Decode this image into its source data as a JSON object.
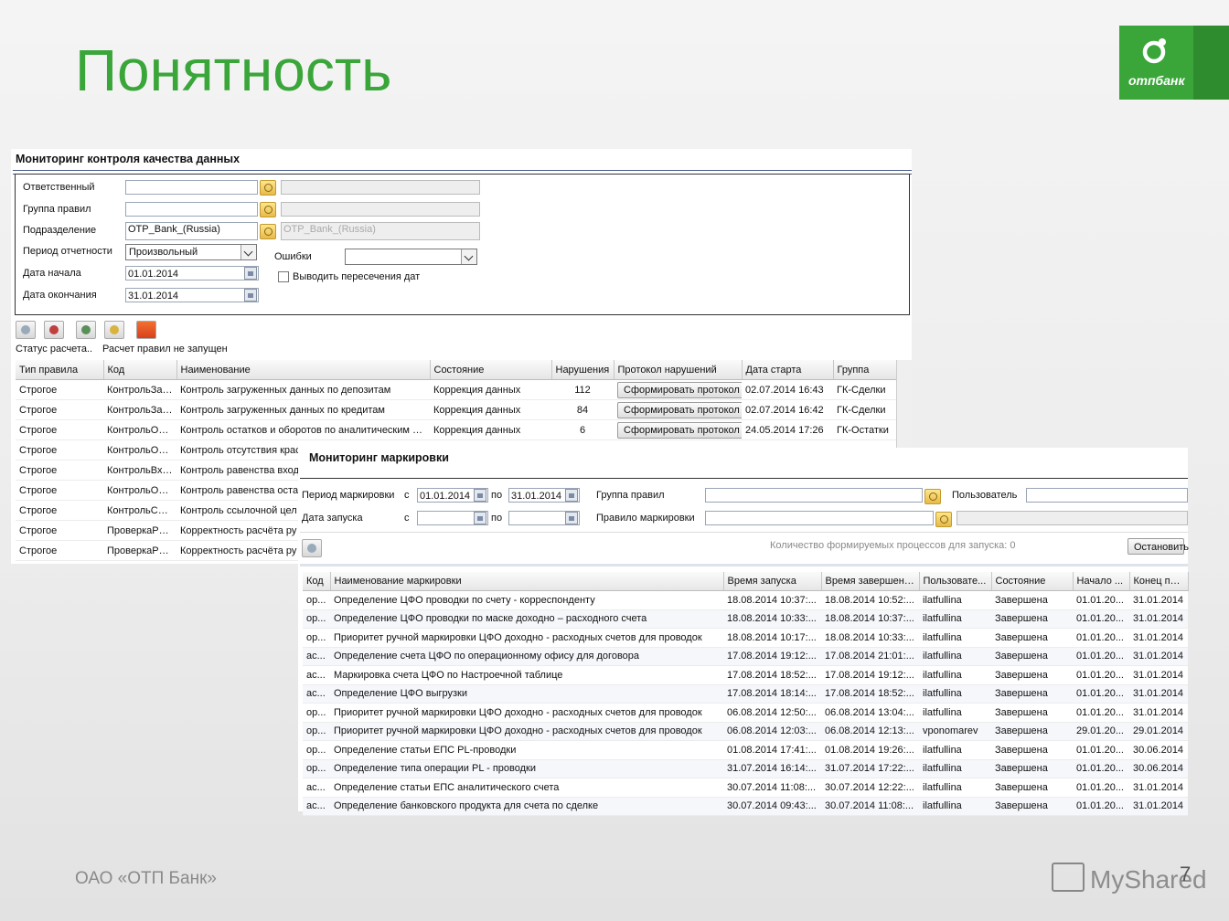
{
  "slide": {
    "title": "Понятность",
    "footer": "ОАО «ОТП Банк»",
    "page_number": "7",
    "logo_text": "отпбанк",
    "watermark": "MyShared",
    "accent_color": "#3aa63a"
  },
  "win1": {
    "title": "Мониторинг контроля качества данных",
    "labels": {
      "responsible": "Ответственный",
      "rule_group": "Группа правил",
      "division": "Подразделение",
      "period": "Период отчетности",
      "date_start": "Дата начала",
      "date_end": "Дата окончания",
      "errors": "Ошибки",
      "overlap": "Выводить пересечения дат"
    },
    "values": {
      "division": "OTP_Bank_(Russia)",
      "division_name": "OTP_Bank_(Russia)",
      "period": "Произвольный",
      "date_start": "01.01.2014",
      "date_end": "31.01.2014"
    },
    "status_label": "Статус расчета..",
    "status_value": "Расчет правил не запущен",
    "columns": [
      "Тип правила",
      "Код",
      "Наименование",
      "Состояние",
      "Нарушения",
      "Протокол нарушений",
      "Дата старта",
      "Группа"
    ],
    "button_label": "Сформировать протокол",
    "rows": [
      {
        "type": "Строгое",
        "code": "КонтрольЗап...",
        "name": "Контроль загруженных данных по депозитам",
        "state": "Коррекция данных",
        "violations": "112",
        "protocol": true,
        "start": "02.07.2014 16:43",
        "group": "ГК-Сделки"
      },
      {
        "type": "Строгое",
        "code": "КонтрольЗап...",
        "name": "Контроль загруженных данных по кредитам",
        "state": "Коррекция данных",
        "violations": "84",
        "protocol": true,
        "start": "02.07.2014 16:42",
        "group": "ГК-Сделки"
      },
      {
        "type": "Строгое",
        "code": "КонтрольОст...",
        "name": "Контроль остатков и оборотов по аналитическим сч...",
        "state": "Коррекция данных",
        "violations": "6",
        "protocol": true,
        "start": "24.05.2014 17:26",
        "group": "ГК-Остатки"
      },
      {
        "type": "Строгое",
        "code": "КонтрольОтс...",
        "name": "Контроль отсутствия крас",
        "state": "",
        "violations": "",
        "protocol": false,
        "start": "",
        "group": ""
      },
      {
        "type": "Строгое",
        "code": "КонтрольВхИ...",
        "name": "Контроль равенства вход",
        "state": "",
        "violations": "",
        "protocol": false,
        "start": "",
        "group": ""
      },
      {
        "type": "Строгое",
        "code": "КонтрольОст...",
        "name": "Контроль равенства оста",
        "state": "",
        "violations": "",
        "protocol": false,
        "start": "",
        "group": ""
      },
      {
        "type": "Строгое",
        "code": "КонтрольСсы...",
        "name": "Контроль ссылочной цел",
        "state": "",
        "violations": "",
        "protocol": false,
        "start": "",
        "group": ""
      },
      {
        "type": "Строгое",
        "code": "ПроверкаРуб...",
        "name": "Корректность расчёта ру",
        "state": "",
        "violations": "",
        "protocol": false,
        "start": "",
        "group": ""
      },
      {
        "type": "Строгое",
        "code": "ПроверкаРуб...",
        "name": "Корректность расчёта ру",
        "state": "",
        "violations": "",
        "protocol": false,
        "start": "",
        "group": ""
      }
    ]
  },
  "win2": {
    "title": "Мониторинг маркировки",
    "labels": {
      "period": "Период маркировки",
      "launch_date": "Дата запуска",
      "from": "с",
      "to": "по",
      "rule_group": "Группа правил",
      "rule": "Правило маркировки",
      "user": "Пользователь",
      "process_count": "Количество формируемых процессов для запуска: 0",
      "stop_button": "Остановить"
    },
    "values": {
      "period_from": "01.01.2014",
      "period_to": "31.01.2014"
    },
    "columns": [
      "Код",
      "Наименование маркировки",
      "Время запуска",
      "Время завершения",
      "Пользовате...",
      "Состояние",
      "Начало ...",
      "Конец пе..."
    ],
    "rows": [
      {
        "code": "ор...",
        "name": "Определение ЦФО проводки по счету - корреспонденту",
        "launch": "18.08.2014 10:37:...",
        "finish": "18.08.2014 10:52:...",
        "user": "ilatfullina",
        "state": "Завершена",
        "begin": "01.01.20...",
        "end": "31.01.2014"
      },
      {
        "code": "ор...",
        "name": "Определение ЦФО проводки по маске доходно – расходного счета",
        "launch": "18.08.2014 10:33:...",
        "finish": "18.08.2014 10:37:...",
        "user": "ilatfullina",
        "state": "Завершена",
        "begin": "01.01.20...",
        "end": "31.01.2014"
      },
      {
        "code": "ор...",
        "name": "Приоритет ручной маркировки ЦФО доходно - расходных счетов для проводок",
        "launch": "18.08.2014 10:17:...",
        "finish": "18.08.2014 10:33:...",
        "user": "ilatfullina",
        "state": "Завершена",
        "begin": "01.01.20...",
        "end": "31.01.2014"
      },
      {
        "code": "ас...",
        "name": "Определение счета ЦФО по операционному офису для договора",
        "launch": "17.08.2014 19:12:...",
        "finish": "17.08.2014 21:01:...",
        "user": "ilatfullina",
        "state": "Завершена",
        "begin": "01.01.20...",
        "end": "31.01.2014"
      },
      {
        "code": "ас...",
        "name": "Маркировка счета ЦФО по Настроечной таблице",
        "launch": "17.08.2014 18:52:...",
        "finish": "17.08.2014 19:12:...",
        "user": "ilatfullina",
        "state": "Завершена",
        "begin": "01.01.20...",
        "end": "31.01.2014"
      },
      {
        "code": "ас...",
        "name": "Определение ЦФО выгрузки",
        "launch": "17.08.2014 18:14:...",
        "finish": "17.08.2014 18:52:...",
        "user": "ilatfullina",
        "state": "Завершена",
        "begin": "01.01.20...",
        "end": "31.01.2014"
      },
      {
        "code": "ор...",
        "name": "Приоритет ручной маркировки ЦФО доходно - расходных счетов для проводок",
        "launch": "06.08.2014 12:50:...",
        "finish": "06.08.2014 13:04:...",
        "user": "ilatfullina",
        "state": "Завершена",
        "begin": "01.01.20...",
        "end": "31.01.2014"
      },
      {
        "code": "ор...",
        "name": "Приоритет ручной маркировки ЦФО доходно - расходных счетов для проводок",
        "launch": "06.08.2014 12:03:...",
        "finish": "06.08.2014 12:13:...",
        "user": "vponomarev",
        "state": "Завершена",
        "begin": "29.01.20...",
        "end": "29.01.2014"
      },
      {
        "code": "ор...",
        "name": "Определение статьи ЕПС PL-проводки",
        "launch": "01.08.2014 17:41:...",
        "finish": "01.08.2014 19:26:...",
        "user": "ilatfullina",
        "state": "Завершена",
        "begin": "01.01.20...",
        "end": "30.06.2014"
      },
      {
        "code": "ор...",
        "name": "Определение типа операции PL - проводки",
        "launch": "31.07.2014 16:14:...",
        "finish": "31.07.2014 17:22:...",
        "user": "ilatfullina",
        "state": "Завершена",
        "begin": "01.01.20...",
        "end": "30.06.2014"
      },
      {
        "code": "ас...",
        "name": "Определение статьи ЕПС аналитического счета",
        "launch": "30.07.2014 11:08:...",
        "finish": "30.07.2014 12:22:...",
        "user": "ilatfullina",
        "state": "Завершена",
        "begin": "01.01.20...",
        "end": "31.01.2014"
      },
      {
        "code": "ас...",
        "name": "Определение банковского продукта для счета по сделке",
        "launch": "30.07.2014 09:43:...",
        "finish": "30.07.2014 11:08:...",
        "user": "ilatfullina",
        "state": "Завершена",
        "begin": "01.01.20...",
        "end": "31.01.2014"
      }
    ]
  }
}
